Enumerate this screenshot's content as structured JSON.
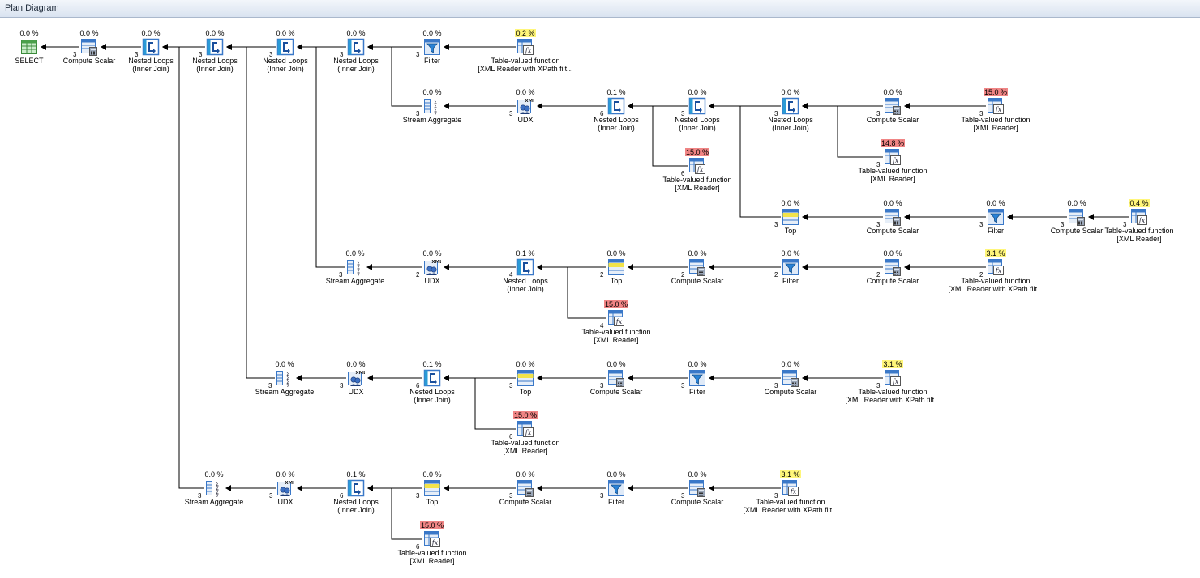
{
  "window": {
    "title": "Plan Diagram"
  },
  "nodes": [
    {
      "pct": "0.0 %",
      "level": "",
      "name1": "SELECT",
      "name2": "",
      "icon": "select-icon",
      "cnt": ""
    },
    {
      "pct": "0.0 %",
      "level": "",
      "name1": "Compute Scalar",
      "name2": "",
      "icon": "compute-scalar-icon",
      "cnt": "3"
    },
    {
      "pct": "0.0 %",
      "level": "",
      "name1": "Nested Loops",
      "name2": "(Inner Join)",
      "icon": "nested-loops-icon",
      "cnt": "3"
    },
    {
      "pct": "0.0 %",
      "level": "",
      "name1": "Nested Loops",
      "name2": "(Inner Join)",
      "icon": "nested-loops-icon",
      "cnt": "3"
    },
    {
      "pct": "0.0 %",
      "level": "",
      "name1": "Nested Loops",
      "name2": "(Inner Join)",
      "icon": "nested-loops-icon",
      "cnt": "3"
    },
    {
      "pct": "0.0 %",
      "level": "",
      "name1": "Nested Loops",
      "name2": "(Inner Join)",
      "icon": "nested-loops-icon",
      "cnt": "3"
    },
    {
      "pct": "0.0 %",
      "level": "",
      "name1": "Filter",
      "name2": "",
      "icon": "filter-icon",
      "cnt": "3"
    },
    {
      "pct": "0.2 %",
      "level": "mid",
      "name1": "Table-valued function",
      "name2": "[XML Reader with XPath filt...",
      "icon": "table-valued-function-icon",
      "cnt": ""
    },
    {
      "pct": "0.0 %",
      "level": "",
      "name1": "Stream Aggregate",
      "name2": "",
      "icon": "stream-aggregate-icon",
      "cnt": "3"
    },
    {
      "pct": "0.0 %",
      "level": "",
      "name1": "UDX",
      "name2": "",
      "icon": "udx-icon",
      "cnt": "3"
    },
    {
      "pct": "0.1 %",
      "level": "",
      "name1": "Nested Loops",
      "name2": "(Inner Join)",
      "icon": "nested-loops-icon",
      "cnt": "6"
    },
    {
      "pct": "0.0 %",
      "level": "",
      "name1": "Nested Loops",
      "name2": "(Inner Join)",
      "icon": "nested-loops-icon",
      "cnt": "3"
    },
    {
      "pct": "0.0 %",
      "level": "",
      "name1": "Nested Loops",
      "name2": "(Inner Join)",
      "icon": "nested-loops-icon",
      "cnt": "3"
    },
    {
      "pct": "0.0 %",
      "level": "",
      "name1": "Compute Scalar",
      "name2": "",
      "icon": "compute-scalar-icon",
      "cnt": "3"
    },
    {
      "pct": "15.0 %",
      "level": "hi",
      "name1": "Table-valued function",
      "name2": "[XML Reader]",
      "icon": "table-valued-function-icon",
      "cnt": "3"
    },
    {
      "pct": "15.0 %",
      "level": "hi",
      "name1": "Table-valued function",
      "name2": "[XML Reader]",
      "icon": "table-valued-function-icon",
      "cnt": "6"
    },
    {
      "pct": "14.8 %",
      "level": "hi",
      "name1": "Table-valued function",
      "name2": "[XML Reader]",
      "icon": "table-valued-function-icon",
      "cnt": "3"
    },
    {
      "pct": "0.0 %",
      "level": "",
      "name1": "Top",
      "name2": "",
      "icon": "top-icon",
      "cnt": "3"
    },
    {
      "pct": "0.0 %",
      "level": "",
      "name1": "Compute Scalar",
      "name2": "",
      "icon": "compute-scalar-icon",
      "cnt": "3"
    },
    {
      "pct": "0.0 %",
      "level": "",
      "name1": "Filter",
      "name2": "",
      "icon": "filter-icon",
      "cnt": "3"
    },
    {
      "pct": "0.0 %",
      "level": "",
      "name1": "Compute Scalar",
      "name2": "",
      "icon": "compute-scalar-icon",
      "cnt": "3"
    },
    {
      "pct": "0.4 %",
      "level": "mid",
      "name1": "Table-valued function",
      "name2": "[XML Reader]",
      "icon": "table-valued-function-icon",
      "cnt": "3"
    },
    {
      "pct": "0.0 %",
      "level": "",
      "name1": "Stream Aggregate",
      "name2": "",
      "icon": "stream-aggregate-icon",
      "cnt": "3"
    },
    {
      "pct": "0.0 %",
      "level": "",
      "name1": "UDX",
      "name2": "",
      "icon": "udx-icon",
      "cnt": "2"
    },
    {
      "pct": "0.1 %",
      "level": "",
      "name1": "Nested Loops",
      "name2": "(Inner Join)",
      "icon": "nested-loops-icon",
      "cnt": "4"
    },
    {
      "pct": "0.0 %",
      "level": "",
      "name1": "Top",
      "name2": "",
      "icon": "top-icon",
      "cnt": "2"
    },
    {
      "pct": "0.0 %",
      "level": "",
      "name1": "Compute Scalar",
      "name2": "",
      "icon": "compute-scalar-icon",
      "cnt": "2"
    },
    {
      "pct": "0.0 %",
      "level": "",
      "name1": "Filter",
      "name2": "",
      "icon": "filter-icon",
      "cnt": "2"
    },
    {
      "pct": "0.0 %",
      "level": "",
      "name1": "Compute Scalar",
      "name2": "",
      "icon": "compute-scalar-icon",
      "cnt": "2"
    },
    {
      "pct": "3.1 %",
      "level": "mid",
      "name1": "Table-valued function",
      "name2": "[XML Reader with XPath filt...",
      "icon": "table-valued-function-icon",
      "cnt": "2"
    },
    {
      "pct": "15.0 %",
      "level": "hi",
      "name1": "Table-valued function",
      "name2": "[XML Reader]",
      "icon": "table-valued-function-icon",
      "cnt": "4"
    },
    {
      "pct": "0.0 %",
      "level": "",
      "name1": "Stream Aggregate",
      "name2": "",
      "icon": "stream-aggregate-icon",
      "cnt": "3"
    },
    {
      "pct": "0.0 %",
      "level": "",
      "name1": "UDX",
      "name2": "",
      "icon": "udx-icon",
      "cnt": "3"
    },
    {
      "pct": "0.1 %",
      "level": "",
      "name1": "Nested Loops",
      "name2": "(Inner Join)",
      "icon": "nested-loops-icon",
      "cnt": "6"
    },
    {
      "pct": "0.0 %",
      "level": "",
      "name1": "Top",
      "name2": "",
      "icon": "top-icon",
      "cnt": "3"
    },
    {
      "pct": "0.0 %",
      "level": "",
      "name1": "Compute Scalar",
      "name2": "",
      "icon": "compute-scalar-icon",
      "cnt": "3"
    },
    {
      "pct": "0.0 %",
      "level": "",
      "name1": "Filter",
      "name2": "",
      "icon": "filter-icon",
      "cnt": "3"
    },
    {
      "pct": "0.0 %",
      "level": "",
      "name1": "Compute Scalar",
      "name2": "",
      "icon": "compute-scalar-icon",
      "cnt": "3"
    },
    {
      "pct": "3.1 %",
      "level": "mid",
      "name1": "Table-valued function",
      "name2": "[XML Reader with XPath filt...",
      "icon": "table-valued-function-icon",
      "cnt": "3"
    },
    {
      "pct": "15.0 %",
      "level": "hi",
      "name1": "Table-valued function",
      "name2": "[XML Reader]",
      "icon": "table-valued-function-icon",
      "cnt": "6"
    },
    {
      "pct": "0.0 %",
      "level": "",
      "name1": "Stream Aggregate",
      "name2": "",
      "icon": "stream-aggregate-icon",
      "cnt": "3"
    },
    {
      "pct": "0.0 %",
      "level": "",
      "name1": "UDX",
      "name2": "",
      "icon": "udx-icon",
      "cnt": "3"
    },
    {
      "pct": "0.1 %",
      "level": "",
      "name1": "Nested Loops",
      "name2": "(Inner Join)",
      "icon": "nested-loops-icon",
      "cnt": "6"
    },
    {
      "pct": "0.0 %",
      "level": "",
      "name1": "Top",
      "name2": "",
      "icon": "top-icon",
      "cnt": "3"
    },
    {
      "pct": "0.0 %",
      "level": "",
      "name1": "Compute Scalar",
      "name2": "",
      "icon": "compute-scalar-icon",
      "cnt": "3"
    },
    {
      "pct": "0.0 %",
      "level": "",
      "name1": "Filter",
      "name2": "",
      "icon": "filter-icon",
      "cnt": "3"
    },
    {
      "pct": "0.0 %",
      "level": "",
      "name1": "Compute Scalar",
      "name2": "",
      "icon": "compute-scalar-icon",
      "cnt": "3"
    },
    {
      "pct": "3.1 %",
      "level": "mid",
      "name1": "Table-valued function",
      "name2": "[XML Reader with XPath filt...",
      "icon": "table-valued-function-icon",
      "cnt": "3"
    },
    {
      "pct": "15.0 %",
      "level": "hi",
      "name1": "Table-valued function",
      "name2": "[XML Reader]",
      "icon": "table-valued-function-icon",
      "cnt": "6"
    }
  ],
  "udx_badge": "XML",
  "colors": {
    "high_cost": "#f08585",
    "mid_cost": "#fff67a",
    "edge": "#000000",
    "icon_blue": "#3a78c8"
  }
}
